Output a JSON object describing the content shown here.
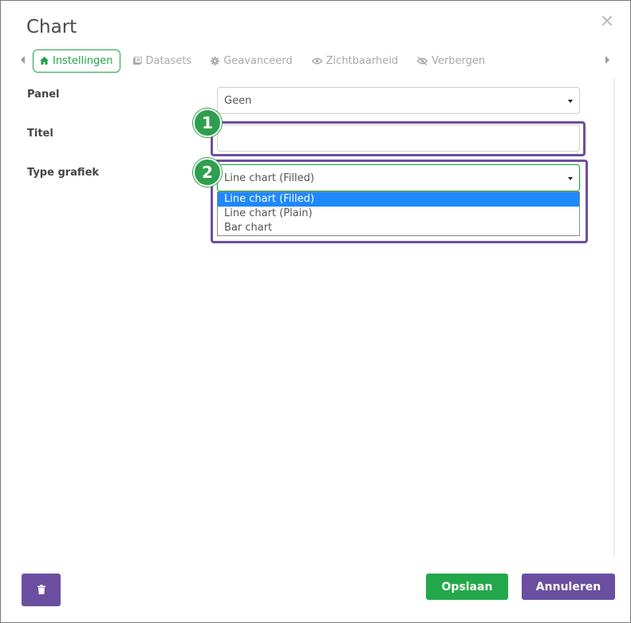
{
  "dialog": {
    "title": "Chart",
    "close_glyph": "✕"
  },
  "tabs": [
    {
      "label": "Instellingen",
      "icon": "home-icon",
      "active": true
    },
    {
      "label": "Datasets",
      "icon": "list-icon",
      "active": false
    },
    {
      "label": "Geavanceerd",
      "icon": "gear-icon",
      "active": false
    },
    {
      "label": "Zichtbaarheid",
      "icon": "eye-icon",
      "active": false
    },
    {
      "label": "Verbergen",
      "icon": "eye-off-icon",
      "active": false
    }
  ],
  "form": {
    "panel": {
      "label": "Panel",
      "value": "Geen"
    },
    "titel": {
      "label": "Titel",
      "value": ""
    },
    "type": {
      "label": "Type grafiek",
      "value": "Line chart (Filled)",
      "options": [
        "Line chart (Filled)",
        "Line chart (Plain)",
        "Bar chart"
      ]
    }
  },
  "annotations": {
    "badge1": "1",
    "badge2": "2"
  },
  "footer": {
    "save_label": "Opslaan",
    "cancel_label": "Annuleren"
  },
  "colors": {
    "accent_green": "#22a84a",
    "accent_purple": "#6a4fa0",
    "selected_option": "#1e88ff"
  }
}
